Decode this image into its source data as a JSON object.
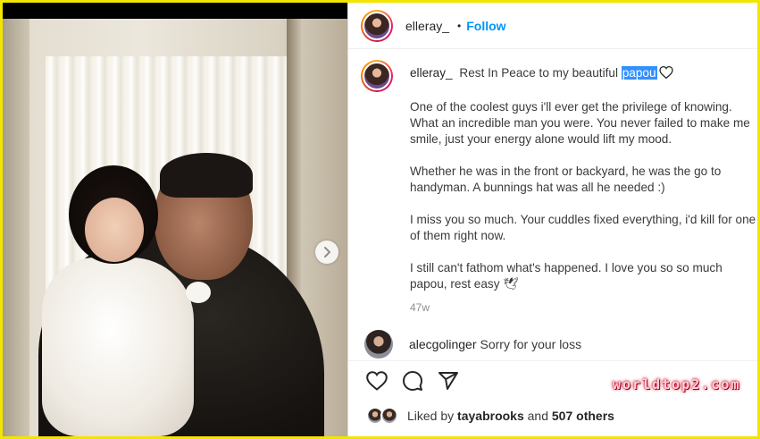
{
  "post": {
    "username": "elleray_",
    "dot": "•",
    "follow_label": "Follow",
    "caption": {
      "username": "elleray_",
      "title_before": "Rest In Peace to my beautiful",
      "title_highlight": "papou",
      "paragraphs": [
        "One of the coolest guys i'll ever get the privilege of knowing. What an incredible man you were. You never failed to make me smile, just your energy alone would lift my mood.",
        "Whether he was in the front or backyard, he was the go to handyman. A bunnings hat was all he needed :)",
        "I miss you so much. Your cuddles fixed everything, i'd kill for one of them right now.",
        "I still can't fathom what's happened. I love you so so much papou, rest easy 🕊"
      ],
      "time_ago": "47w"
    },
    "comment": {
      "username": "alecgolinger",
      "text": "Sorry for your loss"
    },
    "likes": {
      "prefix": "Liked by",
      "user": "tayabrooks",
      "and": "and",
      "count": "507 others"
    }
  },
  "watermark": "worldtop2.com",
  "icons": {
    "like": "heart-icon",
    "comment": "comment-icon",
    "share": "share-icon",
    "next": "chevron-right-icon"
  },
  "colors": {
    "frame": "#f2e600",
    "follow": "#0095f6",
    "highlight": "#3390ff"
  }
}
